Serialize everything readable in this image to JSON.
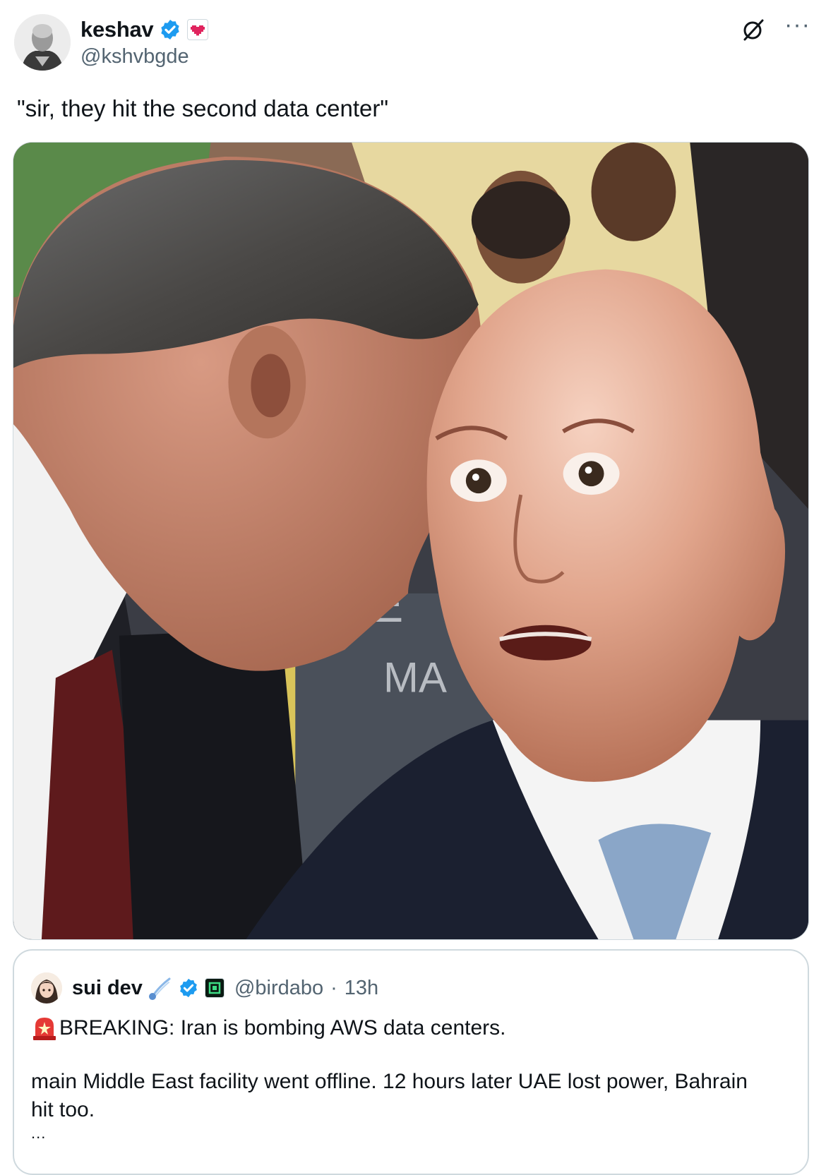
{
  "author": {
    "display_name": "keshav",
    "handle": "@kshvbgde",
    "avatar_icon": "avatar-portrait-icon",
    "verified_icon": "verified-badge-icon",
    "affiliate_icon": "pixel-heart-badge-icon"
  },
  "actions": {
    "grok_icon": "grok-icon",
    "more_icon": "more-options-icon",
    "more_label": "···"
  },
  "tweet": {
    "text": "\"sir, they hit the second data center\""
  },
  "media": {
    "icon": "meme-photo-image",
    "sign_text_1": "KE",
    "sign_text_2": "MA"
  },
  "quote": {
    "display_name": "sui dev",
    "handle": "@birdabo",
    "separator": "·",
    "timestamp": "13h",
    "avatar_icon": "anime-avatar-icon",
    "line1_emoji_icon": "rotating-light-icon",
    "line1": "BREAKING: Iran is bombing AWS data centers.",
    "line2": "main Middle East facility went offline. 12 hours later UAE lost power, Bahrain hit too.",
    "ellipsis": "..."
  },
  "colors": {
    "verified": "#1d9bf0",
    "muted": "#536471",
    "text": "#0f1419",
    "border": "#cfd9de"
  }
}
